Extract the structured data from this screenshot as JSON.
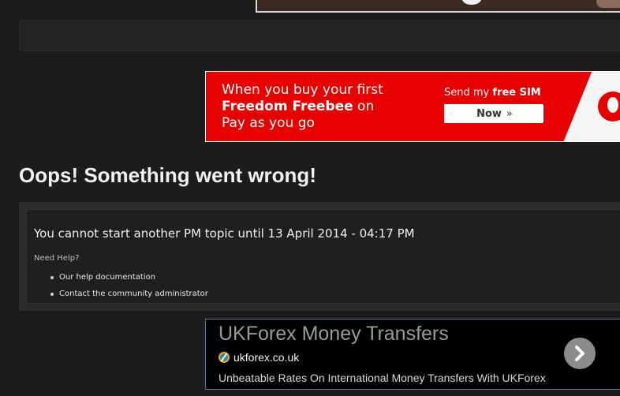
{
  "vodafone_ad": {
    "line1": "When you buy your first",
    "line2_bold": "Freedom Freebee",
    "line2_rest": " on",
    "line3": "Pay as you go",
    "send_prefix": "Send my ",
    "send_bold": "free SIM",
    "now_label": "Now",
    "now_chevrons": "»",
    "logo_icon": "vodafone-speechmark-icon",
    "brand_color": "#e60000"
  },
  "error": {
    "title": "Oops! Something went wrong!",
    "message": "You cannot start another PM topic until 13 April 2014 - 04:17 PM",
    "help_label": "Need Help?",
    "help_links": [
      {
        "label": "Our help documentation"
      },
      {
        "label": "Contact the community administrator"
      }
    ]
  },
  "ukforex_ad": {
    "title": "UKForex Money Transfers",
    "domain": "ukforex.co.uk",
    "description": "Unbeatable Rates On International Money Transfers With UKForex",
    "favicon_icon": "ukforex-favicon-icon",
    "arrow_icon": "chevron-right-icon"
  }
}
